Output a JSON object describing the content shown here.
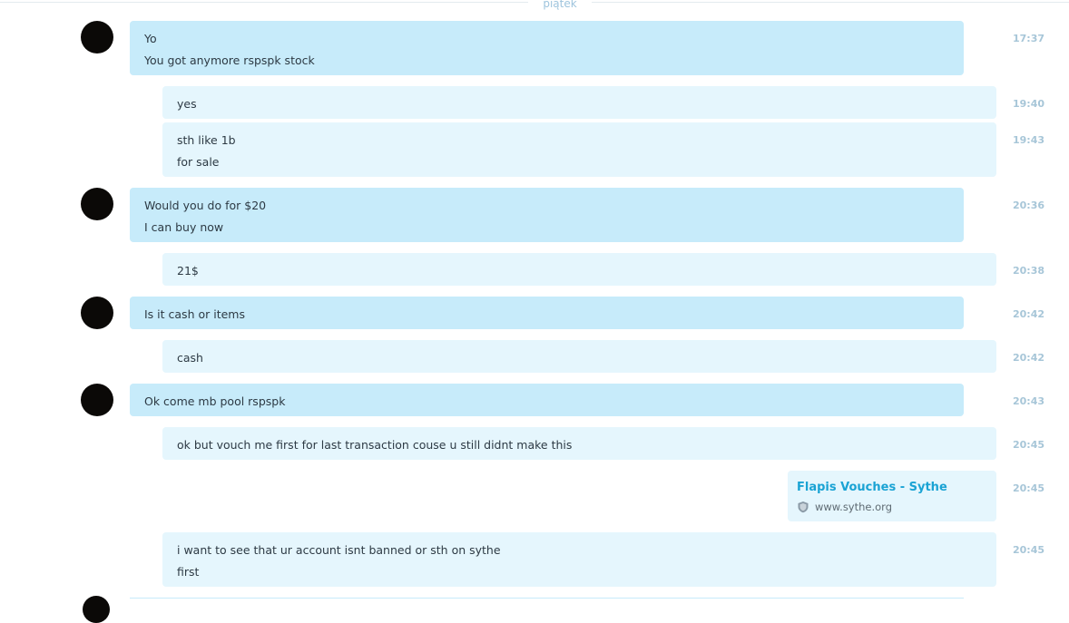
{
  "day_separator": "piątek",
  "messages": [
    {
      "lines": [
        "Yo",
        "You got anymore rspspk stock"
      ],
      "time": "17:37"
    },
    {
      "lines": [
        "yes"
      ],
      "time": "19:40"
    },
    {
      "lines": [
        "sth like 1b",
        "for sale"
      ],
      "time": "19:43"
    },
    {
      "lines": [
        "Would you do for $20",
        "I can buy now"
      ],
      "time": "20:36"
    },
    {
      "lines": [
        "21$"
      ],
      "time": "20:38"
    },
    {
      "lines": [
        "Is it cash or items"
      ],
      "time": "20:42"
    },
    {
      "lines": [
        "cash"
      ],
      "time": "20:42"
    },
    {
      "lines": [
        "Ok come mb pool rspspk"
      ],
      "time": "20:43"
    },
    {
      "lines": [
        "ok but vouch me first for last transaction couse u still didnt make this"
      ],
      "time": "20:45"
    },
    {
      "lines": [
        "i want to see that ur account isnt banned or sth on sythe",
        "first"
      ],
      "time": "20:45"
    }
  ],
  "link_preview": {
    "title": "Flapis Vouches - Sythe",
    "url": "www.sythe.org",
    "icon": "shield-icon",
    "time": "20:45"
  },
  "colors": {
    "incoming_bubble": "#c7ebfa",
    "outgoing_bubble": "#e5f6fd",
    "timestamp": "#a7c6d8",
    "link_title": "#1aa3d4"
  }
}
